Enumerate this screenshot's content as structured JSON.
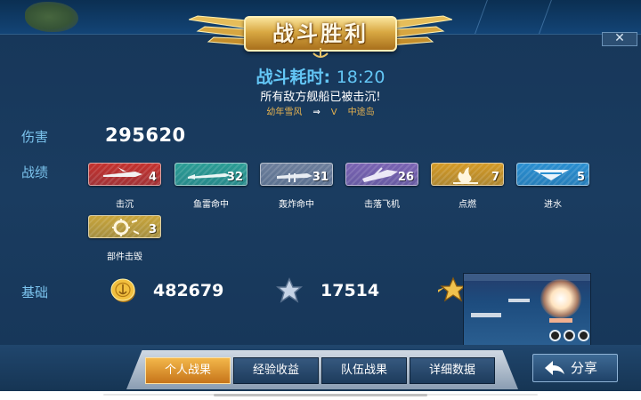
{
  "header": {
    "title": "战斗胜利",
    "close_label": "✕"
  },
  "summary": {
    "time_label": "战斗耗时: ",
    "time_value": "18:20",
    "result_text": "所有敌方舰船已被击沉!",
    "route_from": "幼年雪风",
    "route_arrow": "⇒",
    "route_mode": "V",
    "route_to": "中途岛"
  },
  "damage": {
    "label": "伤害",
    "value": "295620"
  },
  "record": {
    "label": "战绩",
    "badges": [
      {
        "label": "击沉",
        "count": "4",
        "color": "#c4312d",
        "icon": "plane-sunk-icon"
      },
      {
        "label": "鱼雷命中",
        "count": "32",
        "color": "#2b9d95",
        "icon": "torpedo-icon"
      },
      {
        "label": "轰炸命中",
        "count": "31",
        "color": "#6d7f9c",
        "icon": "bomb-icon"
      },
      {
        "label": "击落飞机",
        "count": "26",
        "color": "#7b63b3",
        "icon": "plane-down-icon"
      },
      {
        "label": "点燃",
        "count": "7",
        "color": "#d49a25",
        "icon": "fire-icon"
      },
      {
        "label": "进水",
        "count": "5",
        "color": "#2a8fd1",
        "icon": "flood-icon"
      },
      {
        "label": "部件击毁",
        "count": "3",
        "color": "#c9a53a",
        "icon": "gear-broken-icon"
      }
    ]
  },
  "base": {
    "label": "基础",
    "coin_value": "482679",
    "xp_value": "17514"
  },
  "tabs": [
    {
      "label": "个人战果",
      "active": true
    },
    {
      "label": "经验收益",
      "active": false
    },
    {
      "label": "队伍战果",
      "active": false
    },
    {
      "label": "详细数据",
      "active": false
    }
  ],
  "share": {
    "label": "分享"
  }
}
